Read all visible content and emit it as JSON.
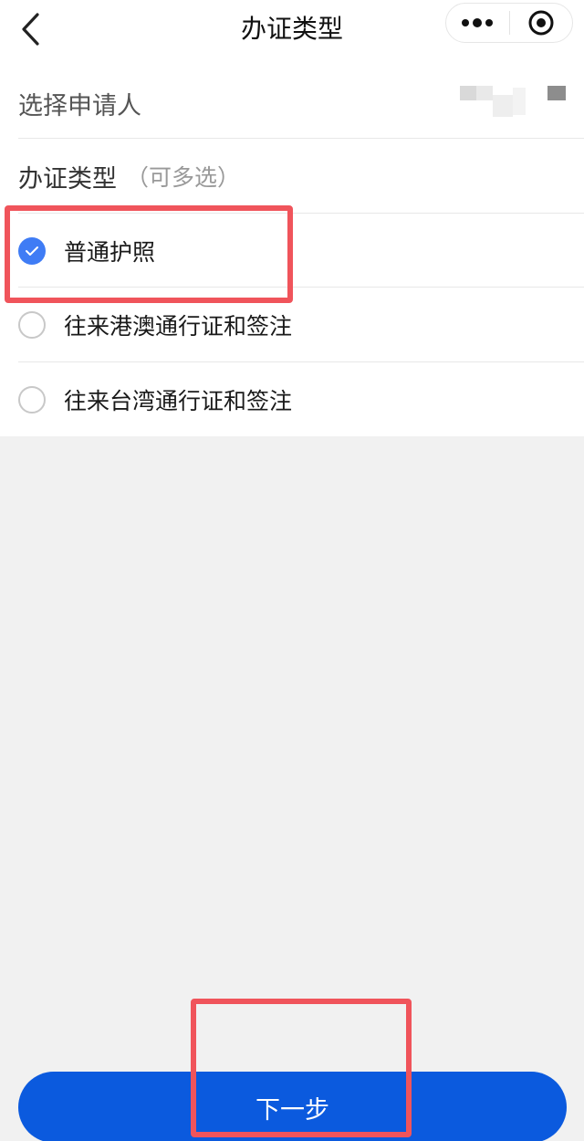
{
  "nav": {
    "title": "办证类型",
    "back_icon": "chevron-left-icon",
    "more_icon": "more-dots-icon",
    "close_icon": "target-close-icon"
  },
  "applicant": {
    "label": "选择申请人"
  },
  "cert_type": {
    "label": "办证类型",
    "hint": "（可多选）",
    "options": [
      {
        "label": "普通护照",
        "checked": true
      },
      {
        "label": "往来港澳通行证和签注",
        "checked": false
      },
      {
        "label": "往来台湾通行证和签注",
        "checked": false
      }
    ]
  },
  "footer": {
    "next_label": "下一步"
  },
  "colors": {
    "accent": "#3f7cf5",
    "button": "#0b5ade",
    "highlight": "#f0545b"
  }
}
